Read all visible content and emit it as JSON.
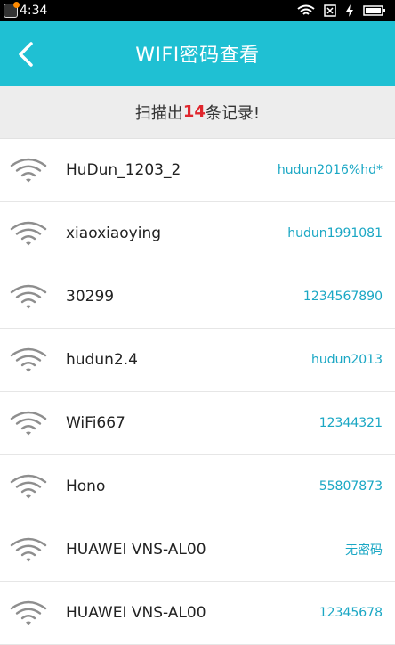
{
  "status_bar": {
    "time": "4:34"
  },
  "header": {
    "title": "WIFI密码查看"
  },
  "summary": {
    "prefix": "扫描出",
    "count": "14",
    "suffix": "条记录!"
  },
  "networks": [
    {
      "ssid": "HuDun_1203_2",
      "password": "hudun2016%hd*"
    },
    {
      "ssid": "xiaoxiaoying",
      "password": "hudun1991081"
    },
    {
      "ssid": "30299",
      "password": "1234567890"
    },
    {
      "ssid": "hudun2.4",
      "password": "hudun2013"
    },
    {
      "ssid": "WiFi667",
      "password": "12344321"
    },
    {
      "ssid": "Hono",
      "password": "55807873"
    },
    {
      "ssid": "HUAWEI VNS-AL00",
      "password": "无密码"
    },
    {
      "ssid": "HUAWEI VNS-AL00",
      "password": "12345678"
    }
  ],
  "colors": {
    "header": "#1fc0d3",
    "password": "#1aa7c4",
    "count": "#e0262d"
  }
}
